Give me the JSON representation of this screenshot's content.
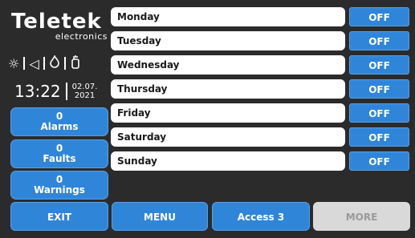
{
  "brand": {
    "name": "Teletek",
    "sub": "electronics"
  },
  "status_icons": [
    "sun-icon",
    "speaker-icon",
    "flame-icon",
    "extinguisher-icon"
  ],
  "clock": {
    "time": "13:22",
    "date_line1": "02.07.",
    "date_line2": "2021"
  },
  "counters": [
    {
      "count": "0",
      "label": "Alarms"
    },
    {
      "count": "0",
      "label": "Faults"
    },
    {
      "count": "0",
      "label": "Warnings"
    }
  ],
  "days": [
    {
      "name": "Monday",
      "state": "OFF"
    },
    {
      "name": "Tuesday",
      "state": "OFF"
    },
    {
      "name": "Wednesday",
      "state": "OFF"
    },
    {
      "name": "Thursday",
      "state": "OFF"
    },
    {
      "name": "Friday",
      "state": "OFF"
    },
    {
      "name": "Saturday",
      "state": "OFF"
    },
    {
      "name": "Sunday",
      "state": "OFF"
    }
  ],
  "bottom": {
    "exit": "EXIT",
    "menu": "MENU",
    "access": "Access 3",
    "more": "MORE"
  },
  "colors": {
    "accent": "#2f86d9",
    "background": "#2b2b2b",
    "disabled": "#d9d9d9"
  }
}
